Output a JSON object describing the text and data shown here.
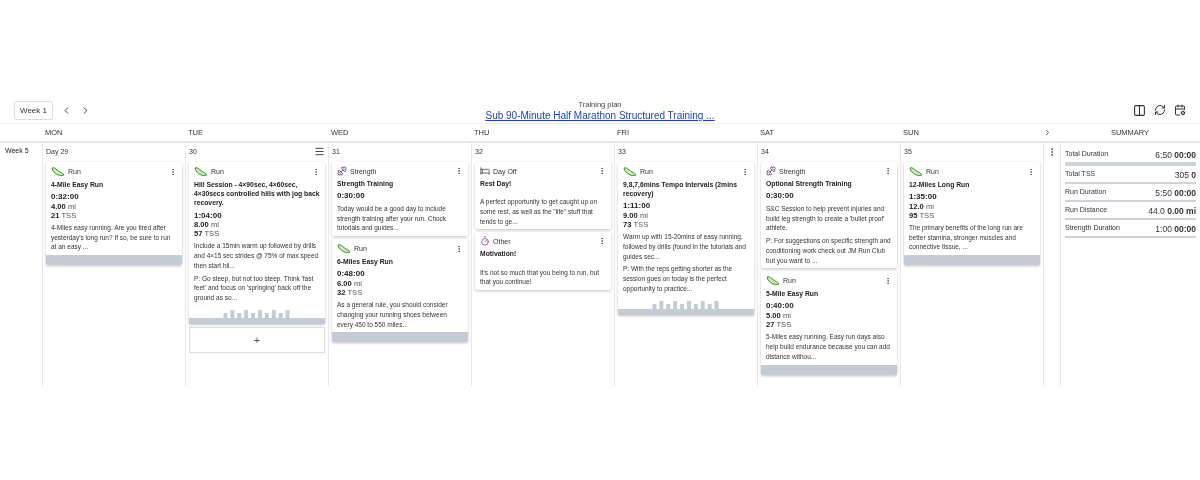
{
  "toolbar": {
    "week_button": "Week 1",
    "plan_label": "Training plan",
    "plan_title": "Sub 90-Minute Half Marathon Structured Training ..."
  },
  "columns": [
    "MON",
    "TUE",
    "WED",
    "THU",
    "FRI",
    "SAT",
    "SUN"
  ],
  "summary_title": "SUMMARY",
  "week": {
    "label": "Week 5",
    "days": [
      {
        "label": "Day 29",
        "menu": false,
        "cards": [
          {
            "kind": "run",
            "type": "Run",
            "title": "4-Mile Easy Run",
            "duration": "0:32:00",
            "distance": {
              "value": "4.00",
              "unit": "mi"
            },
            "tss": {
              "value": "21",
              "unit": "TSS"
            },
            "description": [
              "4-Miles easy running. Are you tired after yesterday's long run? If so, be sure to run at an easy ..."
            ],
            "footer": {
              "kind": "plain"
            }
          }
        ]
      },
      {
        "label": "30",
        "menu": true,
        "add_label": "+",
        "cards": [
          {
            "kind": "run",
            "type": "Run",
            "title": "Hill Session - 4×90sec, 4×60sec, 4×30secs controlled hills with jog back recovery.",
            "duration": "1:04:00",
            "distance": {
              "value": "8.00",
              "unit": "mi"
            },
            "tss": {
              "value": "57",
              "unit": "TSS"
            },
            "description": [
              "Include a 15min warm up followed by drills and 4×15 sec strides @ 75% of max speed then start hil...",
              "P: Go steep, but not too steep. Think 'fast feet' and focus on 'springing' back off the ground as so..."
            ],
            "footer": {
              "kind": "graph"
            }
          }
        ]
      },
      {
        "label": "31",
        "menu": false,
        "cards": [
          {
            "kind": "strength",
            "type": "Strength",
            "title": "Strength Training",
            "duration": "0:30:00",
            "description": [
              "Today would be a good day to include strength training after your run. Chock tutorials and guides..."
            ]
          },
          {
            "kind": "run",
            "type": "Run",
            "title": "6-Miles Easy Run",
            "duration": "0:48:00",
            "distance": {
              "value": "6.00",
              "unit": "mi"
            },
            "tss": {
              "value": "32",
              "unit": "TSS"
            },
            "description": [
              "As a general rule, you should consider changing your running shoes between every 450 to 550 miles..."
            ],
            "footer": {
              "kind": "plain"
            }
          }
        ]
      },
      {
        "label": "32",
        "menu": false,
        "cards": [
          {
            "kind": "dayoff",
            "type": "Day Off",
            "title": "Rest Day!",
            "description": [
              "A perfect opportunity to get caught up on some rest, as well as the \"life\" stuff that tends to ge..."
            ]
          },
          {
            "kind": "other",
            "type": "Other",
            "title": "Motivation!",
            "description": [
              "It's not so much that you being to run, but that you continue!"
            ]
          }
        ]
      },
      {
        "label": "33",
        "menu": false,
        "cards": [
          {
            "kind": "run",
            "type": "Run",
            "title": "9,8,7,6mins Tempo Intervals (2mins recovery)",
            "duration": "1:11:00",
            "distance": {
              "value": "9.00",
              "unit": "mi"
            },
            "tss": {
              "value": "73",
              "unit": "TSS"
            },
            "description": [
              "Warm up with 15-20mins of easy running, followed by drills (found in the tutorials and guides sec...",
              "P: With the reps getting shorter as the session goes on today is the perfect opportunity to practice..."
            ],
            "footer": {
              "kind": "graph"
            }
          }
        ]
      },
      {
        "label": "34",
        "menu": false,
        "cards": [
          {
            "kind": "strength",
            "type": "Strength",
            "title": "Optional Strength Training",
            "duration": "0:30:00",
            "description": [
              "S&C Session to help prevent injuries and build leg strength to create a 'bullet proof' athlete.",
              "P: For suggestions on specific strength and conditioning work check out JM Run Club but you want to ..."
            ]
          },
          {
            "kind": "run",
            "type": "Run",
            "title": "5-Mile Easy Run",
            "duration": "0:40:00",
            "distance": {
              "value": "5.00",
              "unit": "mi"
            },
            "tss": {
              "value": "27",
              "unit": "TSS"
            },
            "description": [
              "5-Miles easy running. Easy run days also help build endurance because you can add distance withou..."
            ],
            "footer": {
              "kind": "plain"
            }
          }
        ]
      },
      {
        "label": "35",
        "menu": false,
        "cards": [
          {
            "kind": "run",
            "type": "Run",
            "title": "12-Miles Long Run",
            "duration": "1:35:00",
            "distance": {
              "value": "12.0",
              "unit": "mi"
            },
            "tss": {
              "value": "95",
              "unit": "TSS"
            },
            "description": [
              "The primary benefits of the long run are better stamina, stronger muscles and connective tissue, ..."
            ],
            "footer": {
              "kind": "plain"
            }
          }
        ]
      }
    ],
    "summary": [
      {
        "label": "Total Duration",
        "planned": "6:50",
        "completed": "00:00"
      },
      {
        "label": "Total TSS",
        "planned": "305",
        "completed": "0"
      },
      {
        "label": "Run Duration",
        "planned": "5:50",
        "completed": "00:00"
      },
      {
        "label": "Run Distance",
        "planned": "44.0",
        "completed": "0.00",
        "unit": "mi"
      },
      {
        "label": "Strength Duration",
        "planned": "1:00",
        "completed": "00:00"
      }
    ]
  }
}
